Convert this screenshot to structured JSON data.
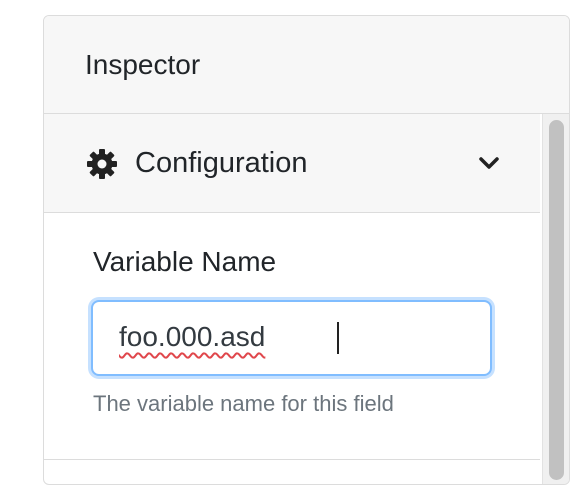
{
  "inspector": {
    "title": "Inspector"
  },
  "section": {
    "title": "Configuration",
    "icon": "gear-icon",
    "toggle_icon": "chevron-down-icon",
    "expanded": true
  },
  "field": {
    "label": "Variable Name",
    "value": "foo.000.asd",
    "help": "The variable name for this field",
    "focused": true,
    "spellcheck_error": true
  },
  "colors": {
    "focus_border": "#80bdff",
    "header_bg": "#f7f7f7",
    "help_text": "#6c757d",
    "spell_underline": "#e0474c"
  }
}
